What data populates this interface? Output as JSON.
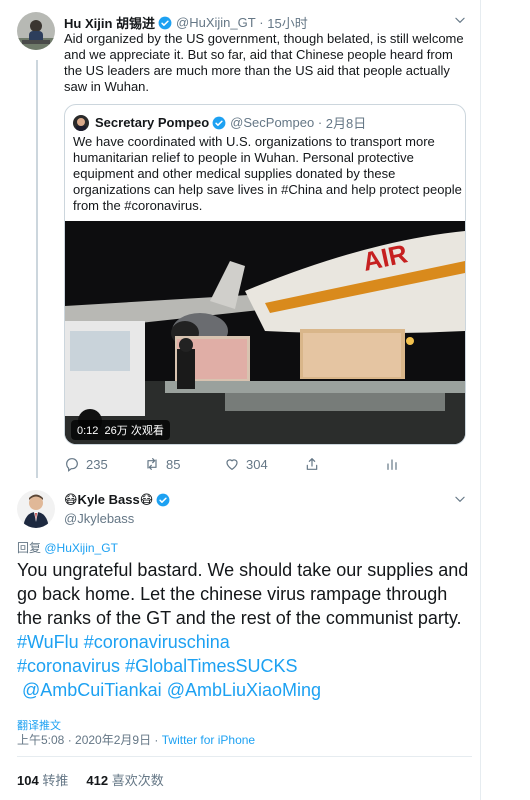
{
  "colors": {
    "accent": "#1da1f2",
    "muted": "#657786",
    "text": "#14171a",
    "border": "#ccd6dd"
  },
  "tweet1": {
    "name": "Hu Xijin 胡锡进",
    "handle": "@HuXijin_GT",
    "time": "15小时",
    "text": "Aid organized by the US government, though belated, is still welcome and we appreciate it. But so far, aid that Chinese people heard from the US leaders are much more than the US aid that people actually saw in Wuhan."
  },
  "quote": {
    "name": "Secretary Pompeo",
    "handle": "@SecPompeo",
    "date": "2月8日",
    "text": "We have coordinated with U.S. organizations to transport more humanitarian relief to people in Wuhan. Personal protective equipment and other medical supplies donated by these organizations can help save lives in #China and help protect people from the #coronavirus.",
    "media": {
      "duration": "0:12",
      "views": "26万 次观看",
      "plane_text": "AIR"
    }
  },
  "actions": {
    "replies": "235",
    "retweets": "85",
    "likes": "304"
  },
  "tweet2": {
    "name": "😷Kyle Bass😷",
    "handle": "@Jkylebass",
    "reply_to_label": "回复",
    "reply_to_handle": "@HuXijin_GT",
    "body_text": "You ungrateful bastard. We should take our supplies and go back home. Let the chinese virus rampage through the ranks of the GT and the rest of the communist party.",
    "hashtags": [
      "#WuFlu",
      "#coronaviruschina",
      "#coronavirus",
      "#GlobalTimesSUCKS"
    ],
    "mentions": [
      "@AmbCuiTiankai",
      "@AmbLiuXiaoMing"
    ],
    "translate": "翻译推文",
    "time": "上午5:08 · 2020年2月9日 · ",
    "source": "Twitter for iPhone",
    "retweets_count": "104",
    "retweets_label": "转推",
    "likes_count": "412",
    "likes_label": "喜欢次数"
  }
}
